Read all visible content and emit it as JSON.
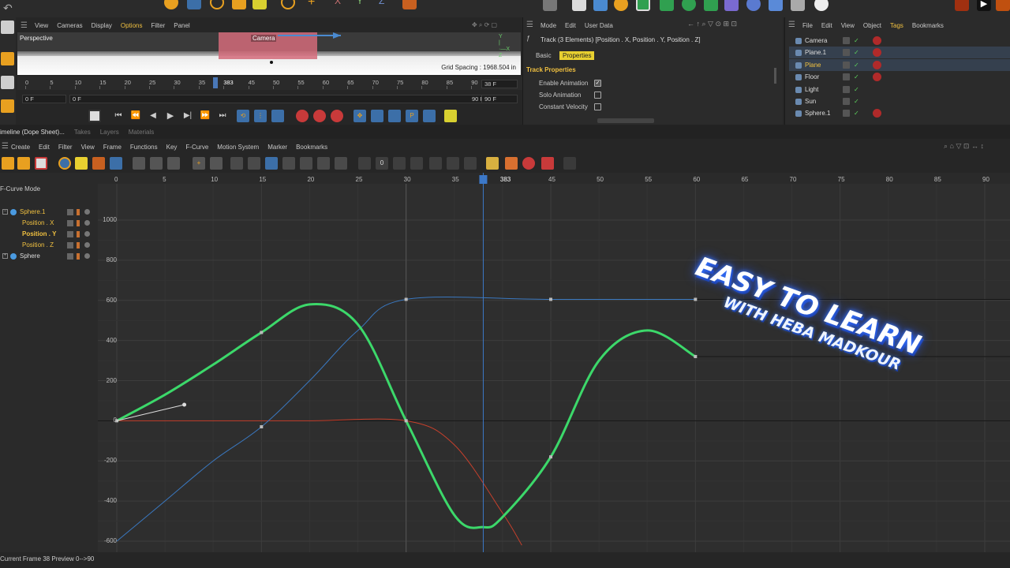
{
  "viewport": {
    "menu": [
      "View",
      "Cameras",
      "Display",
      "Options",
      "Filter",
      "Panel"
    ],
    "title": "Perspective",
    "camera_label": "Camera",
    "grid_spacing": "Grid Spacing : 1968.504 in",
    "ruler_ticks": [
      "0",
      "5",
      "10",
      "15",
      "20",
      "25",
      "30",
      "35",
      "383",
      "45",
      "50",
      "55",
      "60",
      "65",
      "70",
      "75",
      "80",
      "85",
      "90"
    ],
    "frame_start": "0 F",
    "frame_min": "0 F",
    "frame_end": "90 F",
    "frame_current": "38 F",
    "frame_max": "90 F"
  },
  "attributes": {
    "menu": [
      "Mode",
      "Edit",
      "User Data"
    ],
    "track_title": "Track (3 Elements) [Position . X, Position . Y, Position . Z]",
    "tabs": [
      "Basic",
      "Properties"
    ],
    "section": "Track Properties",
    "props": [
      {
        "label": "Enable Animation",
        "checked": true
      },
      {
        "label": "Solo Animation",
        "checked": false
      },
      {
        "label": "Constant Velocity",
        "checked": false
      }
    ]
  },
  "objects": {
    "menu": [
      "File",
      "Edit",
      "View",
      "Object",
      "Tags",
      "Bookmarks"
    ],
    "items": [
      {
        "name": "Camera",
        "color": "#dcdcdc"
      },
      {
        "name": "Plane.1",
        "color": "#dcdcdc"
      },
      {
        "name": "Plane",
        "color": "#f0c040"
      },
      {
        "name": "Floor",
        "color": "#dcdcdc"
      },
      {
        "name": "Light",
        "color": "#dcdcdc"
      },
      {
        "name": "Sun",
        "color": "#dcdcdc"
      },
      {
        "name": "Sphere.1",
        "color": "#dcdcdc"
      }
    ]
  },
  "timeline": {
    "tabs": [
      "imeline (Dope Sheet)...",
      "Takes",
      "Layers",
      "Materials"
    ],
    "menu": [
      "Create",
      "Edit",
      "Filter",
      "View",
      "Frame",
      "Functions",
      "Key",
      "F-Curve",
      "Motion System",
      "Marker",
      "Bookmarks"
    ],
    "mode_label": "F-Curve Mode",
    "tracks": [
      {
        "label": "Sphere.1",
        "color": "#f0c040"
      },
      {
        "label": "Position . X",
        "color": "#f0c040"
      },
      {
        "label": "Position . Y",
        "color": "#f0c040"
      },
      {
        "label": "Position . Z",
        "color": "#f0c040"
      },
      {
        "label": "Sphere",
        "color": "#dcdcdc"
      }
    ],
    "x_ticks": [
      "0",
      "5",
      "10",
      "15",
      "20",
      "25",
      "30",
      "35",
      "383",
      "45",
      "50",
      "55",
      "60",
      "65",
      "70",
      "75",
      "80",
      "85",
      "90"
    ],
    "y_ticks": [
      "1000",
      "800",
      "600",
      "400",
      "200",
      "0",
      "-200",
      "-400",
      "-600"
    ],
    "status": "Current Frame  38  Preview  0-->90"
  },
  "watermark": {
    "line1": "EASY TO LEARN",
    "line2": "WITH HEBA MADKOUR"
  },
  "chart_data": {
    "type": "line",
    "xlabel": "",
    "ylabel": "",
    "xlim": [
      0,
      90
    ],
    "ylim": [
      -620,
      1000
    ],
    "current_frame": 38,
    "series": [
      {
        "color": "#3cd86a",
        "x": [
          0,
          5,
          10,
          15,
          20,
          25,
          30,
          35,
          38,
          40,
          45,
          50,
          55,
          60
        ],
        "y": [
          0,
          130,
          280,
          440,
          580,
          480,
          0,
          -470,
          -530,
          -480,
          -180,
          300,
          450,
          320
        ]
      },
      {
        "color": "#3a78c0",
        "x": [
          0,
          5,
          10,
          15,
          20,
          25,
          30,
          45,
          60
        ],
        "y": [
          -600,
          -400,
          -200,
          -30,
          200,
          450,
          605,
          605,
          605
        ]
      },
      {
        "color": "#c8402c",
        "x": [
          0,
          10,
          20,
          30,
          35,
          40,
          42
        ],
        "y": [
          0,
          0,
          0,
          0,
          -120,
          -460,
          -620
        ]
      }
    ]
  }
}
